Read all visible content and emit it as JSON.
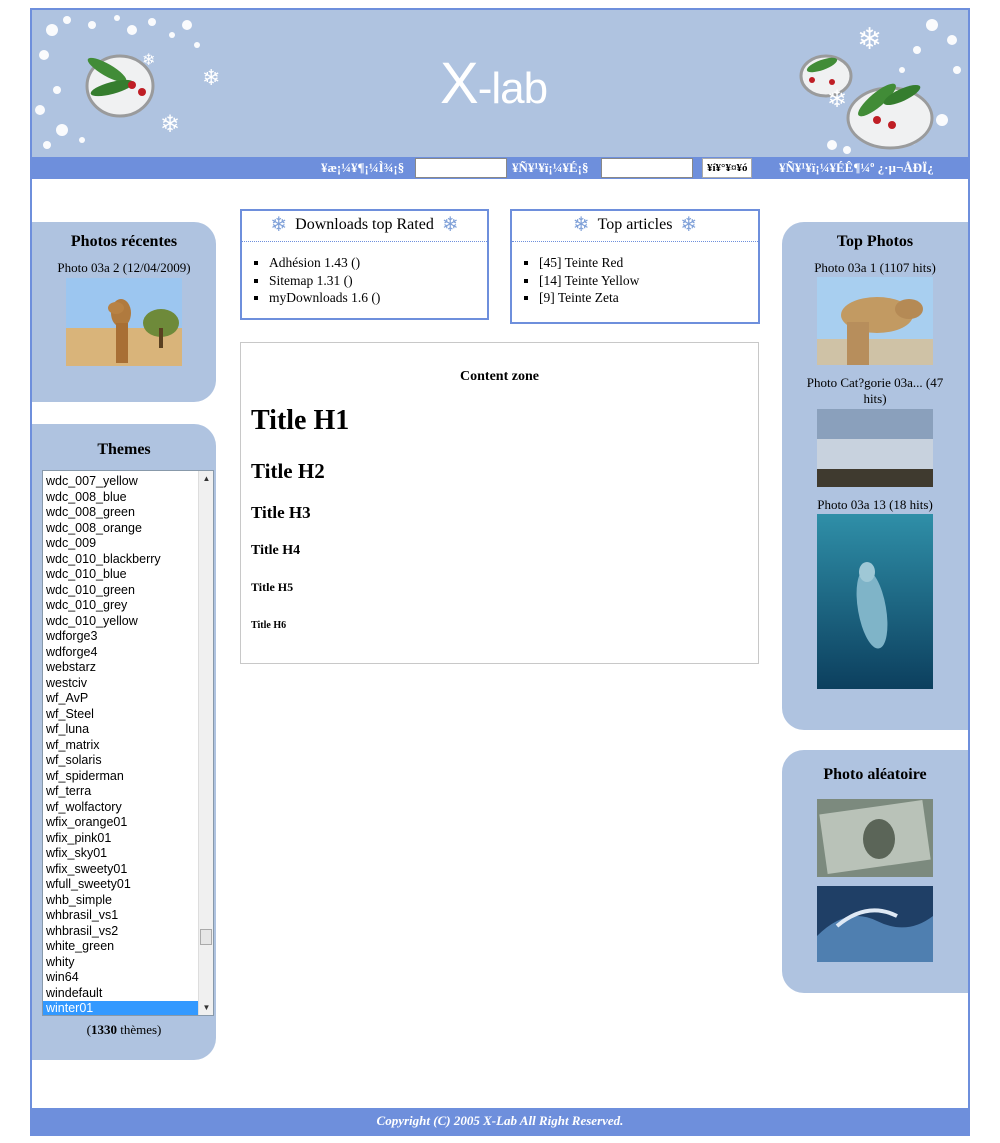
{
  "header": {
    "logo_main": "X",
    "logo_rest": "-lab"
  },
  "navbar": {
    "label1": "¥æ¡¼¥¶¡¼Ì¾¡§",
    "input1_value": "",
    "label2": "¥Ñ¥¹¥ï¡¼¥É¡§",
    "input2_value": "",
    "login_button": "¥í¥°¥¤¥ó",
    "register_link": "¥Ñ¥¹¥ï¡¼¥ÉÊ¶¼º  ¿·µ¬ÅÐÏ¿"
  },
  "photos_recentes": {
    "title": "Photos récentes",
    "caption": "Photo 03a 2 (12/04/2009)"
  },
  "themes": {
    "title": "Themes",
    "items": [
      "wdc_007_yellow",
      "wdc_008_blue",
      "wdc_008_green",
      "wdc_008_orange",
      "wdc_009",
      "wdc_010_blackberry",
      "wdc_010_blue",
      "wdc_010_green",
      "wdc_010_grey",
      "wdc_010_yellow",
      "wdforge3",
      "wdforge4",
      "webstarz",
      "westciv",
      "wf_AvP",
      "wf_Steel",
      "wf_luna",
      "wf_matrix",
      "wf_solaris",
      "wf_spiderman",
      "wf_terra",
      "wf_wolfactory",
      "wfix_orange01",
      "wfix_pink01",
      "wfix_sky01",
      "wfix_sweety01",
      "wfull_sweety01",
      "whb_simple",
      "whbrasil_vs1",
      "whbrasil_vs2",
      "white_green",
      "whity",
      "win64",
      "windefault",
      "winter01"
    ],
    "selected": "winter01",
    "count_open": "(",
    "count_number": "1330",
    "count_suffix": " thèmes)"
  },
  "downloads": {
    "title": "Downloads top Rated",
    "items": [
      "Adhésion 1.43 ()",
      "Sitemap 1.31 ()",
      "myDownloads 1.6 ()"
    ]
  },
  "top_articles": {
    "title": "Top articles",
    "items": [
      "[45] Teinte Red",
      "[14] Teinte Yellow",
      "[9] Teinte Zeta"
    ]
  },
  "content": {
    "zone_title": "Content zone",
    "h1": "Title H1",
    "h2": "Title H2",
    "h3": "Title H3",
    "h4": "Title H4",
    "h5": "Title H5",
    "h6": "Title H6"
  },
  "top_photos": {
    "title": "Top Photos",
    "captions": [
      "Photo 03a 1 (1107 hits)",
      "Photo Cat?gorie 03a... (47 hits)",
      "Photo 03a 13 (18 hits)"
    ]
  },
  "photo_aleatoire": {
    "title": "Photo aléatoire"
  },
  "footer": {
    "copyright": "Copyright (C) 2005 X-Lab All Right Reserved."
  },
  "colors": {
    "header_bg": "#afc3e0",
    "accent": "#6e8fdc",
    "selected": "#3399ff"
  },
  "icons": {
    "snowflake": "snowflake-icon",
    "list_bullet": "square-bullet"
  }
}
